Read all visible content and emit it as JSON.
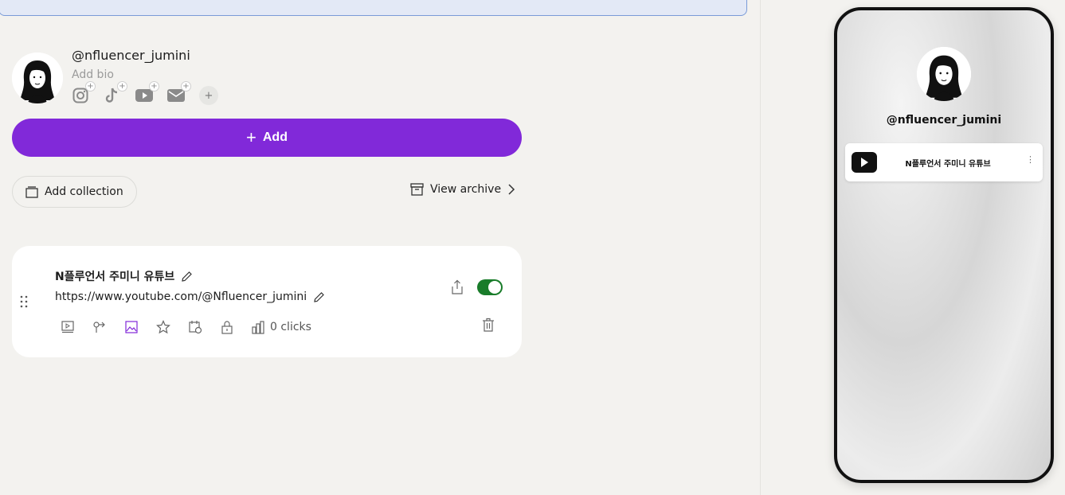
{
  "profile": {
    "handle": "@nfluencer_jumini",
    "bio_placeholder": "Add bio"
  },
  "socials": [
    {
      "icon": "instagram-icon"
    },
    {
      "icon": "tiktok-icon"
    },
    {
      "icon": "youtube-icon"
    },
    {
      "icon": "email-icon"
    }
  ],
  "actions": {
    "add_label": "Add",
    "add_collection_label": "Add collection",
    "view_archive_label": "View archive"
  },
  "link_card": {
    "title": "N플루언서 주미니 유튜브",
    "url": "https://www.youtube.com/@Nfluencer_jumini",
    "clicks": "0 clicks",
    "enabled": true
  },
  "preview": {
    "handle": "@nfluencer_jumini",
    "link_label": "N플루언서 주미니 유튜브",
    "more": "⋮"
  },
  "colors": {
    "accent": "#8129d9",
    "toggle_on": "#197c2a",
    "banner": "#e3e9f6"
  }
}
